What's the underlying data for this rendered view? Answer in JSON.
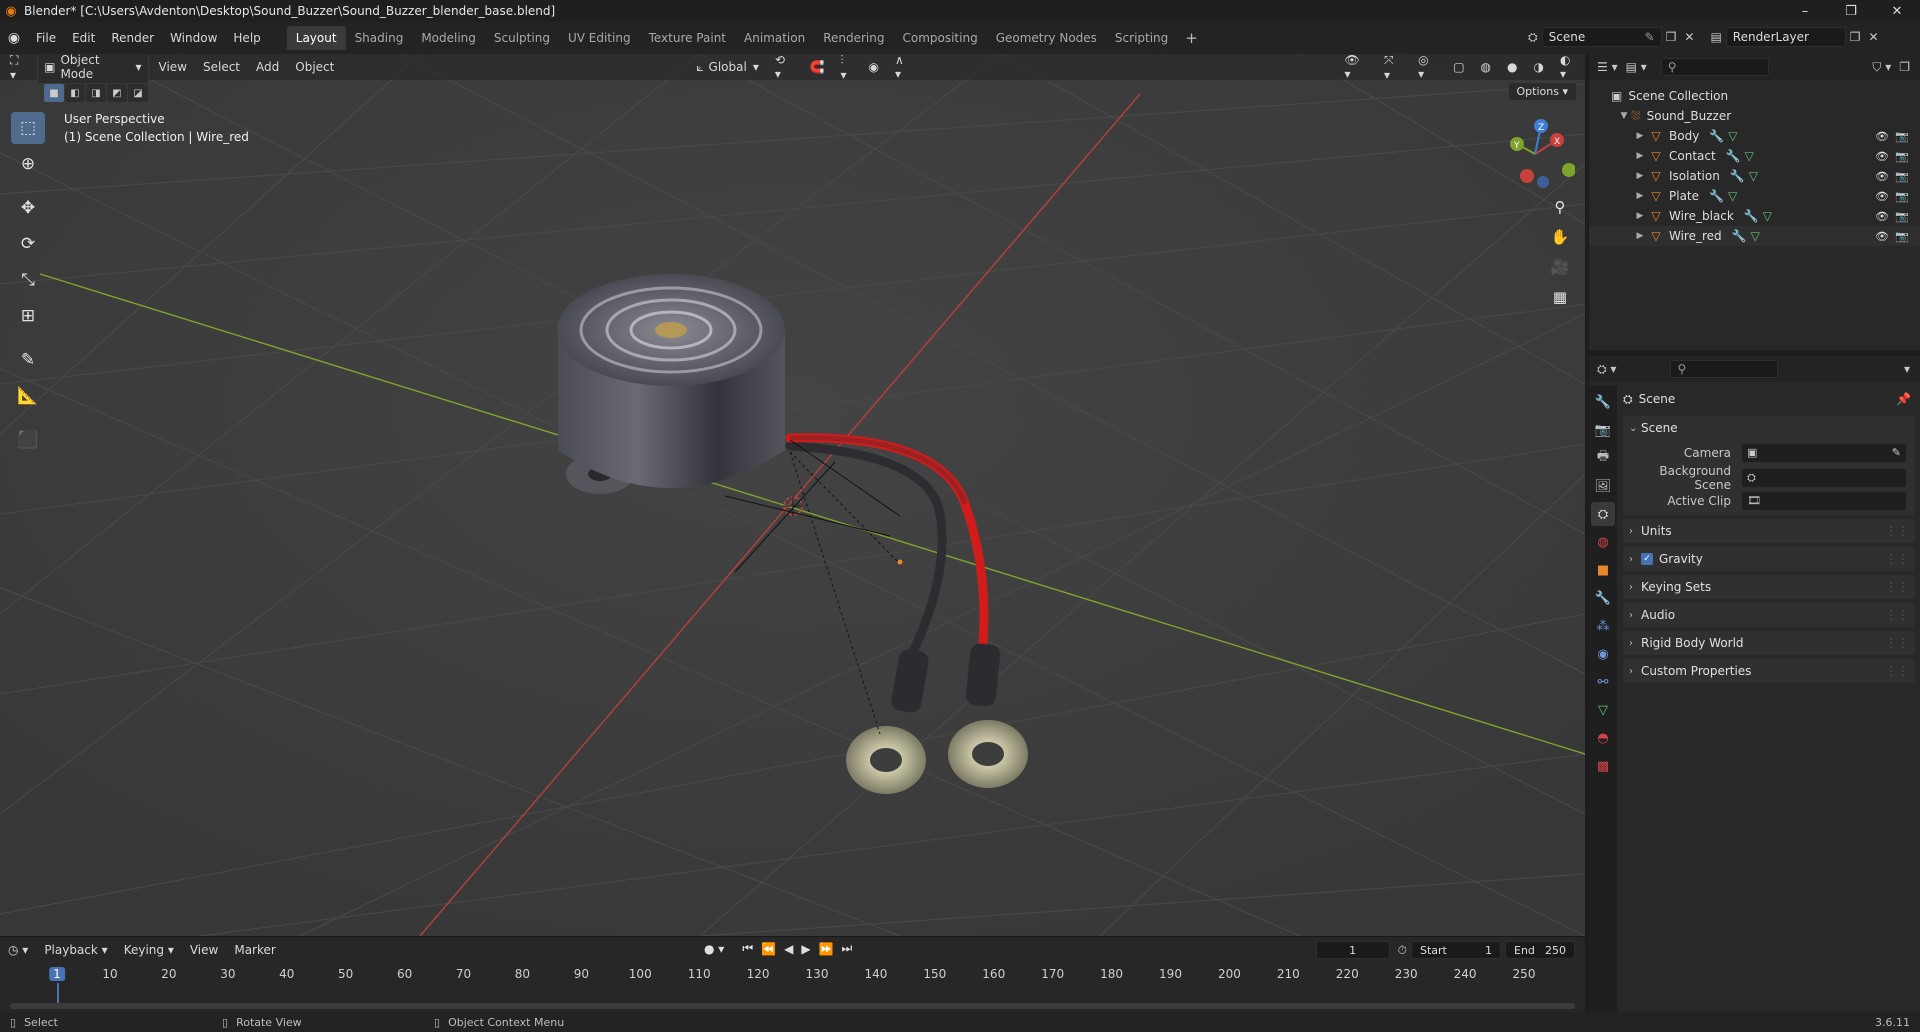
{
  "window": {
    "title": "Blender* [C:\\Users\\Avdenton\\Desktop\\Sound_Buzzer\\Sound_Buzzer_blender_base.blend]",
    "controls": [
      "–",
      "❐",
      "✕"
    ]
  },
  "menu": [
    "File",
    "Edit",
    "Render",
    "Window",
    "Help"
  ],
  "workspaces": [
    "Layout",
    "Shading",
    "Modeling",
    "Sculpting",
    "UV Editing",
    "Texture Paint",
    "Animation",
    "Rendering",
    "Compositing",
    "Geometry Nodes",
    "Scripting"
  ],
  "active_workspace": "Layout",
  "scene_name": "Scene",
  "view_layer": "RenderLayer",
  "viewport": {
    "mode": "Object Mode",
    "menus": [
      "View",
      "Select",
      "Add",
      "Object"
    ],
    "transform_orientation": "Global",
    "options_label": "Options",
    "info_line1": "User Perspective",
    "info_line2": "(1) Scene Collection | Wire_red",
    "gizmo_axes": [
      "X",
      "Y",
      "Z"
    ]
  },
  "timeline": {
    "menus": [
      "Playback",
      "Keying",
      "View",
      "Marker"
    ],
    "current_frame": "1",
    "start_label": "Start",
    "start": "1",
    "end_label": "End",
    "end": "250",
    "ticks": [
      "1",
      "10",
      "20",
      "30",
      "40",
      "50",
      "60",
      "70",
      "80",
      "90",
      "100",
      "110",
      "120",
      "130",
      "140",
      "150",
      "160",
      "170",
      "180",
      "190",
      "200",
      "210",
      "220",
      "230",
      "240",
      "250"
    ]
  },
  "statusbar": {
    "select": "Select",
    "rotate": "Rotate View",
    "context": "Object Context Menu",
    "version": "3.6.11"
  },
  "outliner": {
    "root": "Scene Collection",
    "collection": "Sound_Buzzer",
    "objects": [
      "Body",
      "Contact",
      "Isolation",
      "Plate",
      "Wire_black",
      "Wire_red"
    ]
  },
  "properties": {
    "context": "Scene",
    "panel_scene": "Scene",
    "camera_label": "Camera",
    "bg_scene_label": "Background Scene",
    "active_clip_label": "Active Clip",
    "panels": [
      "Units",
      "Gravity",
      "Keying Sets",
      "Audio",
      "Rigid Body World",
      "Custom Properties"
    ]
  },
  "colors": {
    "accent": "#4772b3",
    "object_orange": "#e8882a",
    "mesh_green": "#61c27a",
    "x_axis": "#c8403c",
    "y_axis": "#7ea42c"
  }
}
